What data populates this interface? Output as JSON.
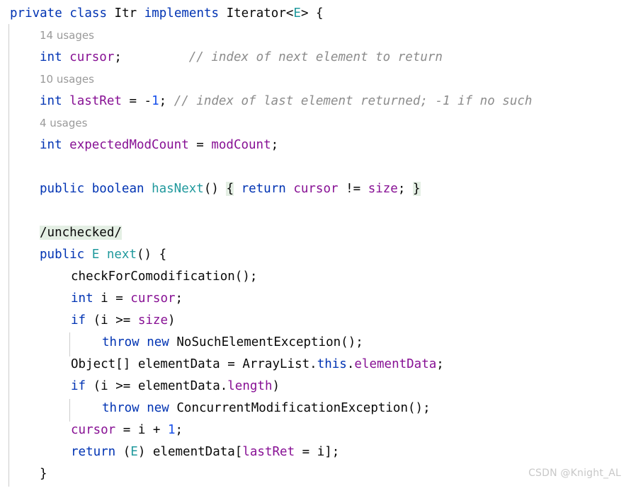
{
  "editor": {
    "language": "java",
    "theme": "IntelliJ Light",
    "colors": {
      "background": "#ffffff",
      "default_text": "#080808",
      "keyword": "#0033b3",
      "type_parameter": "#20999d",
      "field": "#871094",
      "number": "#1750eb",
      "comment": "#8c8c8c",
      "inlay_hint": "#9a9a9a",
      "brace_match_highlight": "#e4efe4",
      "indent_guide": "#cdcdcd",
      "watermark": "#c8c8c8"
    }
  },
  "lines": {
    "l01": {
      "t1": "private",
      "t2": " ",
      "t3": "class",
      "t4": " Itr ",
      "t5": "implements",
      "t6": " Iterator<",
      "t7": "E",
      "t8": "> {"
    },
    "l02": {
      "hint": "14 usages"
    },
    "l03": {
      "t1": "int",
      "t2": " ",
      "t3": "cursor",
      "t4": ";",
      "t5": "         ",
      "t6": "// index of next element to return"
    },
    "l04": {
      "hint": "10 usages"
    },
    "l05": {
      "t1": "int",
      "t2": " ",
      "t3": "lastRet",
      "t4": " = -",
      "t5": "1",
      "t6": "; ",
      "t7": "// index of last element returned; -1 if no such"
    },
    "l06": {
      "hint": "4 usages"
    },
    "l07": {
      "t1": "int",
      "t2": " ",
      "t3": "expectedModCount",
      "t4": " = ",
      "t5": "modCount",
      "t6": ";"
    },
    "l08": {
      "blank": ""
    },
    "l09": {
      "t1": "public",
      "t2": " ",
      "t3": "boolean",
      "t4": " ",
      "t5": "hasNext",
      "t6": "()",
      "t7": " ",
      "t8": "{",
      "t9": " ",
      "t10": "return",
      "t11": " ",
      "t12": "cursor",
      "t13": " != ",
      "t14": "size",
      "t15": ";",
      "t16": " ",
      "t17": "}"
    },
    "l10": {
      "blank": ""
    },
    "l11": {
      "t1": "/unchecked/"
    },
    "l12": {
      "t1": "public",
      "t2": " ",
      "t3": "E",
      "t4": " ",
      "t5": "next",
      "t6": "() {"
    },
    "l13": {
      "t1": "checkForComodification();"
    },
    "l14": {
      "t1": "int",
      "t2": " i = ",
      "t3": "cursor",
      "t4": ";"
    },
    "l15": {
      "t1": "if",
      "t2": " (i >= ",
      "t3": "size",
      "t4": ")"
    },
    "l16": {
      "t1": "throw",
      "t2": " ",
      "t3": "new",
      "t4": " NoSuchElementException();"
    },
    "l17": {
      "t1": "Object[] elementData = ArrayList.",
      "t2": "this",
      "t3": ".",
      "t4": "elementData",
      "t5": ";"
    },
    "l18": {
      "t1": "if",
      "t2": " (i >= elementData.",
      "t3": "length",
      "t4": ")"
    },
    "l19": {
      "t1": "throw",
      "t2": " ",
      "t3": "new",
      "t4": " ConcurrentModificationException();"
    },
    "l20": {
      "t1": "cursor",
      "t2": " = i + ",
      "t3": "1",
      "t4": ";"
    },
    "l21": {
      "t1": "return",
      "t2": " (",
      "t3": "E",
      "t4": ") elementData[",
      "t5": "lastRet",
      "t6": " = i];"
    },
    "l22": {
      "t1": "}"
    }
  },
  "watermark": {
    "text": "CSDN @Knight_AL"
  }
}
